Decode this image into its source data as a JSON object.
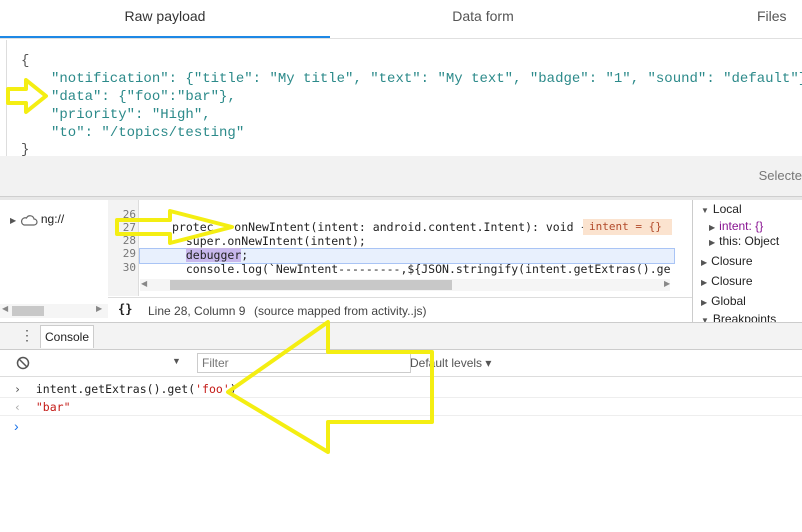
{
  "tabs": [
    {
      "label": "Raw payload",
      "active": true
    },
    {
      "label": "Data form",
      "active": false
    },
    {
      "label": "Files",
      "active": false
    }
  ],
  "payload": {
    "line0": "{",
    "notif_key": "\"notification\"",
    "notif_val": ": {\"title\": \"My title\", \"text\": \"My text\", \"badge\": \"1\", \"sound\": \"default\"},",
    "data_key": "\"data\"",
    "data_val": ": {\"foo\":\"bar\"},",
    "priority_key": "\"priority\"",
    "priority_val": ": \"High\",",
    "to_key": "\"to\"",
    "to_val": ": \"/topics/testing\"",
    "close": "}"
  },
  "selected_label": "Selecte",
  "navigator": {
    "item": "ng://"
  },
  "sources": {
    "lines": [
      {
        "num": "26",
        "text": "protec   onNewIntent(intent: android.content.Intent): void {"
      },
      {
        "num": "27",
        "text": "  super.onNewIntent(intent);"
      },
      {
        "num": "28",
        "text_pre": "  ",
        "text_dbg": "debugger",
        "text_post": ";"
      },
      {
        "num": "29",
        "text": "  console.log(`NewIntent---------,${JSON.stringify(intent.getExtras().get("
      },
      {
        "num": "30",
        "text": ""
      }
    ],
    "inline_value": "intent = {}",
    "status_position": "Line 28, Column 9",
    "status_source": "(source mapped from activity..js)",
    "pretty_icon": "{}"
  },
  "scope": {
    "local": "Local",
    "intent_item": "intent: {}",
    "this_item": "this: Object",
    "closure1": "Closure",
    "closure2": "Closure",
    "global": "Global",
    "breakpoints": "Breakpoints"
  },
  "console": {
    "tab_label": "Console",
    "filter_placeholder": "Filter",
    "levels": "Default levels ▾",
    "input_cmd": "intent.getExtras().get('foo')",
    "cmd_prefix": "intent.getExtras().get(",
    "cmd_arg": "'foo'",
    "cmd_suffix": ")",
    "result": "\"bar\""
  },
  "colors": {
    "annotation_arrow": "#f4ee12",
    "accent_tab": "#1e88e5",
    "json_key": "#2c8a8a"
  }
}
